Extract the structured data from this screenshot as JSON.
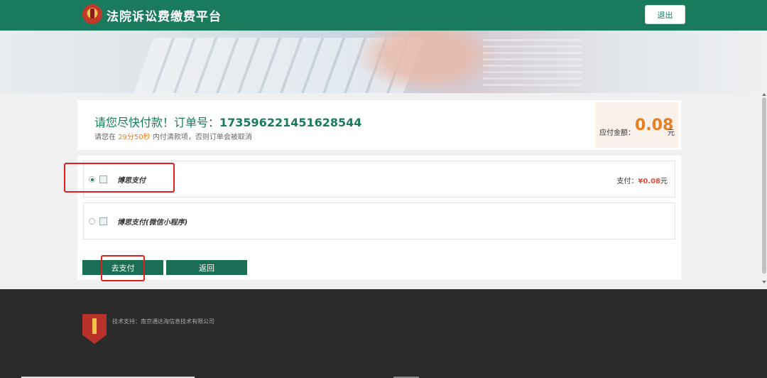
{
  "header": {
    "site_title": "法院诉讼费缴费平台",
    "logout_label": "退出"
  },
  "order": {
    "title_prefix": "请您尽快付款！订单号：",
    "order_number": "173596221451628544",
    "hint_prefix": "请您在",
    "hint_time": "29分50秒",
    "hint_suffix": "内付清款项，否则订单会被取消",
    "amount_label": "应付金额：",
    "amount_value": "0.08",
    "amount_unit": "元"
  },
  "payment": {
    "options": [
      {
        "name": "博思支付",
        "checked": true
      },
      {
        "name": "博思支付(微信小程序)",
        "checked": false
      }
    ],
    "amount_prefix": "支付：",
    "amount_value": "¥0.08",
    "amount_unit": "元",
    "pay_button": "去支付",
    "back_button": "返回"
  },
  "footer": {
    "support_text": "技术支持：南京通达海信息技术有限公司"
  },
  "colors": {
    "brand": "#1a7a5e",
    "accent": "#e67e22",
    "annotation": "#e02020"
  }
}
